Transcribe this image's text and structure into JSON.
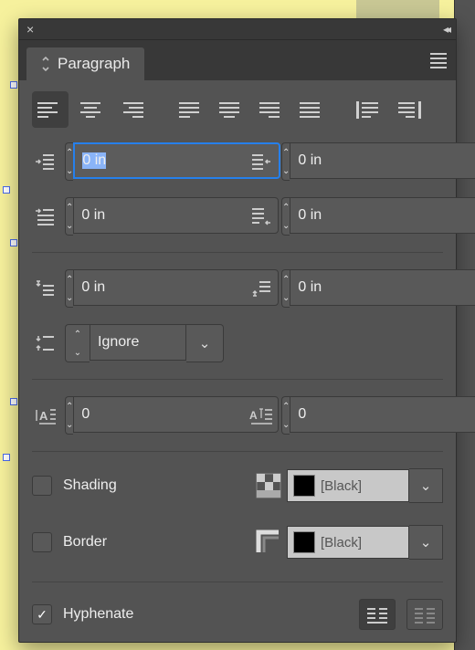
{
  "panel": {
    "title": "Paragraph"
  },
  "alignments": [
    "left",
    "center",
    "right",
    "justify-left",
    "justify-center",
    "justify-right",
    "justify-full",
    "align-toward-spine",
    "align-away-spine"
  ],
  "active_alignment": "left",
  "indents": {
    "left": "0 in",
    "right": "0 in",
    "first_line": "0 in",
    "last_line": "0 in"
  },
  "spacing": {
    "before": "0 in",
    "after": "0 in",
    "between": "Ignore"
  },
  "drop_cap": {
    "lines": "0",
    "chars": "0"
  },
  "shading": {
    "enabled": false,
    "color": "[Black]"
  },
  "border": {
    "enabled": false,
    "color": "[Black]"
  },
  "hyphenate": true,
  "column_mode": "single"
}
